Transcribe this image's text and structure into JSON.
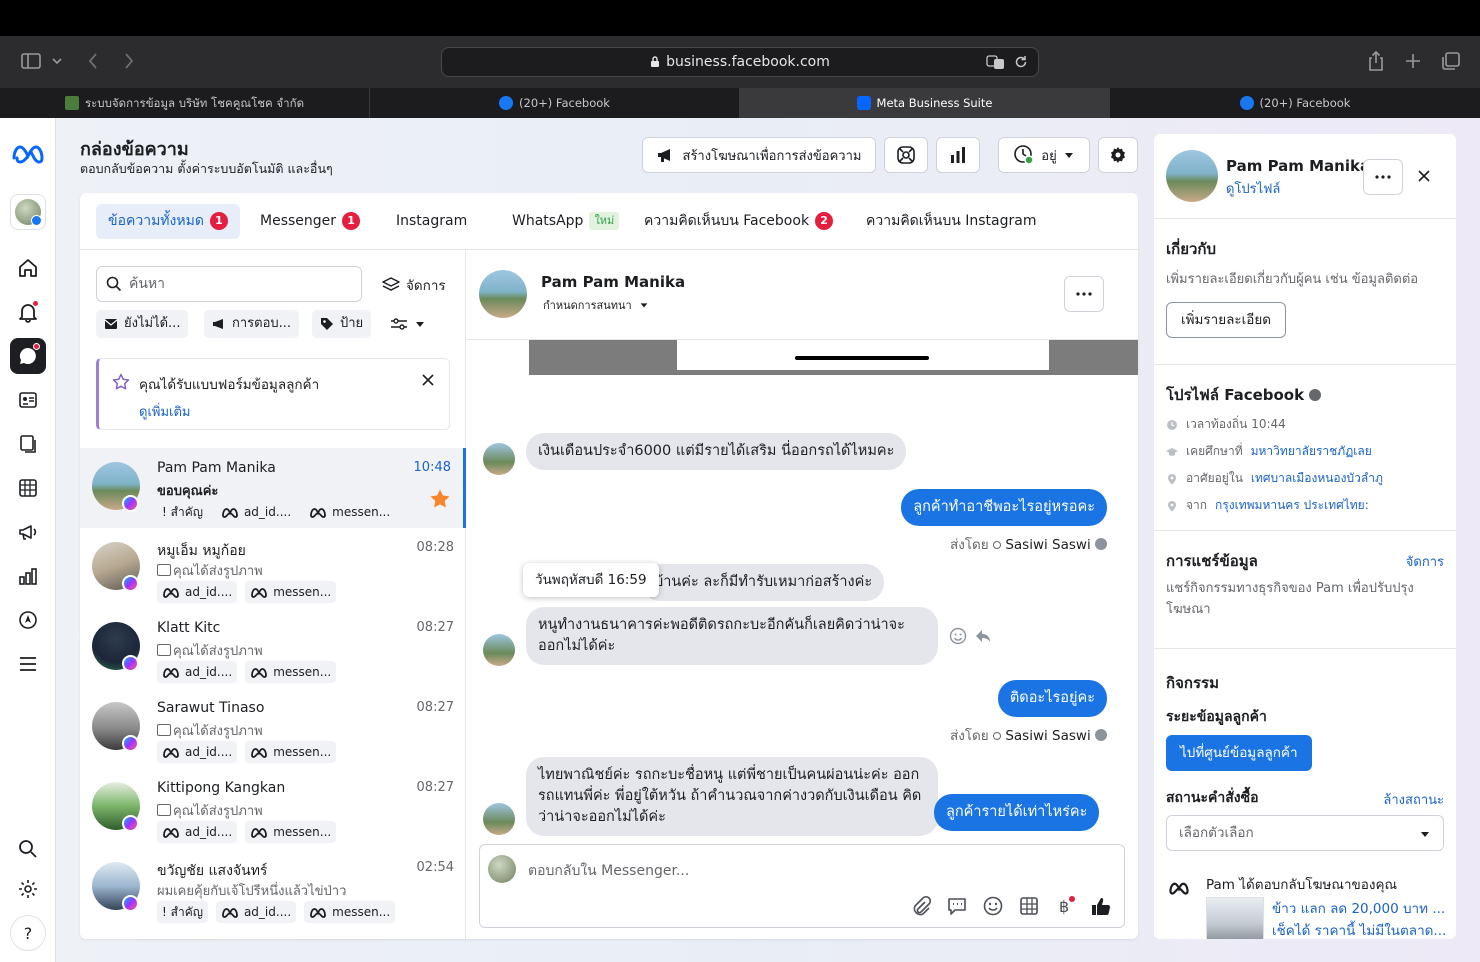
{
  "browser": {
    "url": "business.facebook.com",
    "tabs": [
      {
        "label": "ระบบจัดการข้อมูล บริษัท โชคคูณโชค จำกัด",
        "active": false
      },
      {
        "label": "(20+) Facebook",
        "active": false
      },
      {
        "label": "Meta Business Suite",
        "active": true
      },
      {
        "label": "(20+) Facebook",
        "active": false
      }
    ]
  },
  "header": {
    "title": "กล่องข้อความ",
    "subtitle": "ตอบกลับข้อความ ตั้งค่าระบบอัตโนมัติ และอื่นๆ",
    "ad_button": "สร้างโฆษณาเพื่อการส่งข้อความ",
    "status_label": "อยู่"
  },
  "tabs": [
    {
      "label": "ข้อความทั้งหมด",
      "badge": "1",
      "active": true
    },
    {
      "label": "Messenger",
      "badge": "1"
    },
    {
      "label": "Instagram"
    },
    {
      "label": "WhatsApp",
      "tag": "ใหม่"
    },
    {
      "label": "ความคิดเห็นบน Facebook",
      "badge": "2"
    },
    {
      "label": "ความคิดเห็นบน Instagram"
    }
  ],
  "list": {
    "search_placeholder": "ค้นหา",
    "manage_label": "จัดการ",
    "filters": [
      "ยังไม่ได้...",
      "การตอบ...",
      "ป้าย"
    ],
    "form_notice": {
      "text": "คุณได้รับแบบฟอร์มข้อมูลลูกค้า",
      "link": "ดูเพิ่มเติม"
    },
    "conversations": [
      {
        "name": "Pam Pam Manika",
        "time": "10:48",
        "preview": "ขอบคุณค่ะ",
        "tags": [
          "! สำคัญ",
          "ad_id....",
          "messen..."
        ],
        "selected": true,
        "starred": true
      },
      {
        "name": "หมูเอ็ม หมูก้อย",
        "time": "08:28",
        "preview": "คุณได้ส่งรูปภาพ",
        "tags": [
          "ad_id....",
          "messen..."
        ]
      },
      {
        "name": "Klatt Kitc",
        "time": "08:27",
        "preview": "คุณได้ส่งรูปภาพ",
        "tags": [
          "ad_id....",
          "messen..."
        ]
      },
      {
        "name": "Sarawut Tinaso",
        "time": "08:27",
        "preview": "คุณได้ส่งรูปภาพ",
        "tags": [
          "ad_id....",
          "messen..."
        ]
      },
      {
        "name": "Kittipong Kangkan",
        "time": "08:27",
        "preview": "คุณได้ส่งรูปภาพ",
        "tags": [
          "ad_id....",
          "messen..."
        ]
      },
      {
        "name": "ขวัญชัย แสงจันทร์",
        "time": "02:54",
        "preview": "ผมเคยคุ้ยกับเจ้โปรีหนึ่งแล้วไข่ป่าว",
        "tags": [
          "! สำคัญ",
          "ad_id....",
          "messen..."
        ]
      }
    ]
  },
  "chat": {
    "name": "Pam Pam Manika",
    "assign_label": "กำหนดการสนทนา",
    "tooltip": "วันพฤหัสบดี 16:59",
    "sent_by_prefix": "ส่งโดย",
    "sender": "Sasiwi Saswi",
    "messages": [
      {
        "dir": "in",
        "text": "เงินเดือนประจำ6000 แต่มีรายได้เสริม นี่ออกรถได้ไหมคะ"
      },
      {
        "dir": "out",
        "text": "ลูกค้าทำอาชีพอะไรอยู่หรอคะ"
      },
      {
        "dir": "in",
        "text": "บ้านค่ะ ละก็มีทำรับเหมาก่อสร้างค่ะ"
      },
      {
        "dir": "in",
        "text": "หนูทำงานธนาคารค่ะพอดีติดรถกะบะอีกคันก็เลยคิดว่าน่าจะออกไม่ได้ค่ะ"
      },
      {
        "dir": "out",
        "text": "ติดอะไรอยู่คะ"
      },
      {
        "dir": "in",
        "text": "ไทยพาณิชย์ค่ะ รถกะบะชื่อหนู แต่พี่ชายเป็นคนผ่อนน่ะค่ะ ออกรถแทนพี่ค่ะ พี่อยู่ใต้หวัน ถ้าคำนวณจากค่างวดกับเงินเดือน คิดว่าน่าจะออกไม่ได้ค่ะ"
      },
      {
        "dir": "out",
        "text": "ลูกค้ารายได้เท่าไหร่คะ"
      }
    ],
    "composer_placeholder": "ตอบกลับใน Messenger..."
  },
  "profile": {
    "name": "Pam Pam Manika",
    "view_profile": "ดูโปรไฟล์",
    "about_title": "เกี่ยวกับ",
    "about_text": "เพิ่มรายละเอียดเกี่ยวกับผู้คน เช่น ข้อมูลติดต่อ",
    "about_button": "เพิ่มรายละเอียด",
    "fb_title": "โปรไฟล์ Facebook",
    "fb_rows": [
      {
        "icon": "clock-icon",
        "prefix": "เวลาท้องถิ่น 10:44",
        "link": ""
      },
      {
        "icon": "graduation-cap-icon",
        "prefix": "เคยศึกษาที่",
        "link": "มหาวิทยาลัยราชภัฏเลย"
      },
      {
        "icon": "location-pin-icon",
        "prefix": "อาศัยอยู่ใน",
        "link": "เทศบาลเมืองหนองบัวลำภู"
      },
      {
        "icon": "location-pin-icon",
        "prefix": "จาก",
        "link": "กรุงเทพมหานคร ประเทศไทย:"
      }
    ],
    "share_title": "การแชร์ข้อมูล",
    "share_manage": "จัดการ",
    "share_text": "แชร์กิจกรรมทางธุรกิจของ Pam เพื่อปรับปรุงโฆษณา",
    "activity_title": "กิจกรรม",
    "stage_title": "ระยะข้อมูลลูกค้า",
    "stage_button": "ไปที่ศูนย์ข้อมูลลูกค้า",
    "order_title": "สถานะคำสั่งซื้อ",
    "order_clear": "ล้างสถานะ",
    "order_select": "เลือกตัวเลือก",
    "ad_reply": "Pam ได้ตอบกลับโฆษณาของคุณ",
    "ad_line1": "ข้าว แลก ลด 20,000 บาท ...",
    "ad_line2": "เช็คได้ ราคานี้ ไม่มีในตลาด..."
  },
  "colors": {
    "accent": "#1b74e4",
    "badge": "#e41e3f"
  }
}
